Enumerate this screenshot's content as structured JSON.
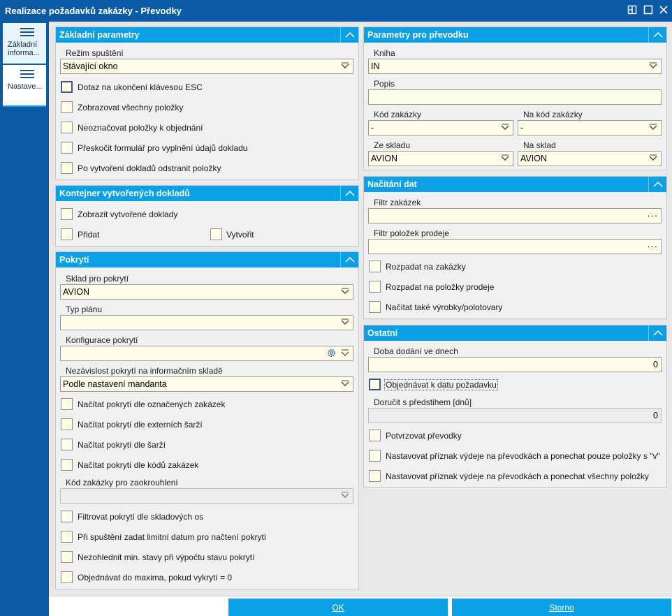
{
  "window": {
    "title": "Realizace požadavků zakázky - Převodky"
  },
  "nav": {
    "items": [
      {
        "label": "Základní informa..."
      },
      {
        "label": "Nastave..."
      }
    ]
  },
  "basic": {
    "header": "Základní parametry",
    "mode_label": "Režim spuštění",
    "mode_value": "Stávající okno",
    "checks": [
      "Dotaz na ukončení klávesou ESC",
      "Zobrazovat všechny položky",
      "Neoznačovat položky k objednání",
      "Přeskočit formulář pro vyplnění údajů dokladu",
      "Po vytvoření dokladů odstranit položky"
    ]
  },
  "container": {
    "header": "Kontejner vytvořených dokladů",
    "show": "Zobrazit vytvořené doklady",
    "add": "Přidat",
    "create": "Vytvořit"
  },
  "coverage": {
    "header": "Pokrytí",
    "warehouse_label": "Sklad pro pokrytí",
    "warehouse_value": "AVION",
    "plan_label": "Typ plánu",
    "plan_value": "",
    "config_label": "Konfigurace pokrytí",
    "config_value": "",
    "indep_label": "Nezávislost pokrytí na informačním skladě",
    "indep_value": "Podle nastavení mandanta",
    "checks1": [
      "Načítat pokrytí dle označených zakázek",
      "Načítat pokrytí dle externích šarží",
      "Načítat pokrytí dle šarží",
      "Načítat pokrytí dle kódů zakázek"
    ],
    "round_label": "Kód zakázky pro zaokrouhlení",
    "round_value": "",
    "checks2": [
      "Filtrovat pokrytí dle skladových os",
      "Při spuštění zadat limitní datum pro načtení pokrytí",
      "Nezohlednit min. stavy při výpočtu stavu pokrytí",
      "Objednávat do maxima, pokud vykrytí = 0"
    ]
  },
  "transfer": {
    "header": "Parametry pro převodku",
    "book_label": "Kniha",
    "book_value": "IN",
    "desc_label": "Popis",
    "desc_value": "",
    "order_label": "Kód zakázky",
    "order_value": "-",
    "to_order_label": "Na kód zakázky",
    "to_order_value": "-",
    "from_wh_label": "Ze skladu",
    "from_wh_value": "AVION",
    "to_wh_label": "Na sklad",
    "to_wh_value": "AVION"
  },
  "loading": {
    "header": "Načítání dat",
    "filter_orders_label": "Filtr zakázek",
    "filter_items_label": "Filtr položek prodeje",
    "checks": [
      "Rozpadat na zakázky",
      "Rozpadat na položky prodeje",
      "Načítat také výrobky/polotovary"
    ]
  },
  "other": {
    "header": "Ostatní",
    "lead_label": "Doba dodání ve dnech",
    "lead_value": "0",
    "order_date": "Objednávat k datu požadavku",
    "advance_label": "Doručit s předstihem [dnů]",
    "advance_value": "0",
    "checks": [
      "Potvrzovat převodky",
      "Nastavovat příznak výdeje na převodkách a ponechat pouze položky s \"v\"",
      "Nastavovat příznak výdeje na převodkách a ponechat všechny položky"
    ]
  },
  "buttons": {
    "ok": "OK",
    "cancel": "Storno"
  },
  "colors": {
    "titlebar": "#0a5aa5",
    "accent": "#0aa0e6"
  }
}
